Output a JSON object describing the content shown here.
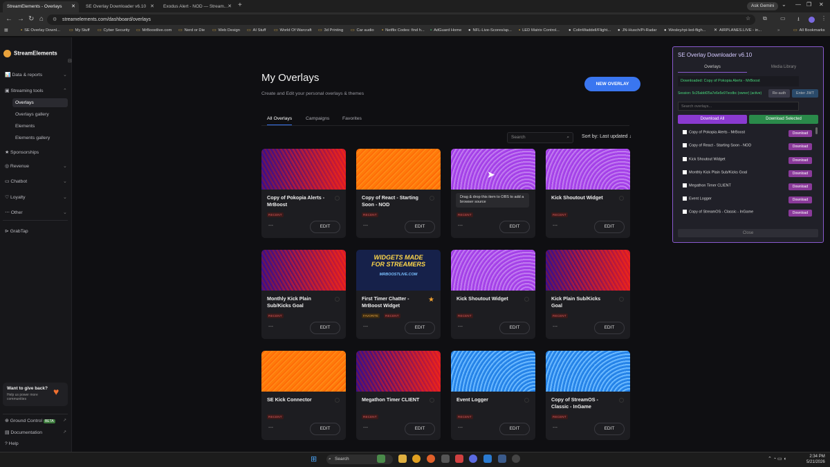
{
  "browser": {
    "tabs": [
      {
        "label": "StreamElements - Overlays"
      },
      {
        "label": "SE Overlay Downloader v6.10"
      },
      {
        "label": "Exodus Alert - NOD — Stream..."
      }
    ],
    "ask_gemini": "Ask Gemini",
    "url": "streamelements.com/dashboard/overlays",
    "bookmarks": [
      "SE Overlay Downl...",
      "My Stuff",
      "Cyber Security",
      "MrBoostlive.com",
      "Nerd or Die",
      "Web Design",
      "AI Stuff",
      "World Of Warcraft",
      "3d Printing",
      "Car audio",
      "Netflix Codes: find h...",
      "AdGuard Home",
      "NFL-Live-Scores/ap...",
      "LED Matrix Control...",
      "ColinWaddell/Flight...",
      "JN-Husch/Pi-Radar",
      "Wesley/rpi-led-fligh...",
      "AIRPLANES.LIVE - in...",
      "All Bookmarks"
    ]
  },
  "sidebar": {
    "brand": "StreamElements",
    "items": [
      {
        "label": "Data & reports"
      },
      {
        "label": "Streaming tools"
      },
      {
        "label": "Overlays"
      },
      {
        "label": "Overlays gallery"
      },
      {
        "label": "Elements"
      },
      {
        "label": "Elements gallery"
      },
      {
        "label": "Sponsorships"
      },
      {
        "label": "Revenue"
      },
      {
        "label": "Chatbot"
      },
      {
        "label": "Loyalty"
      },
      {
        "label": "Other"
      },
      {
        "label": "GrabTap"
      }
    ],
    "giveback_title": "Want to give back?",
    "giveback_text": "Help us power more communities",
    "footer": [
      {
        "label": "Ground Control",
        "badge": "BETA"
      },
      {
        "label": "Documentation"
      },
      {
        "label": "Help"
      }
    ]
  },
  "main": {
    "title": "My Overlays",
    "subtitle": "Create and Edit your personal overlays & themes",
    "new_button": "NEW OVERLAY",
    "tabs": [
      "All Overlays",
      "Campaigns",
      "Favorites"
    ],
    "search_placeholder": "Search",
    "sort": "Sort by: Last updated",
    "tooltip": "Drag & drop this item to OBS to add a browser source",
    "edit_label": "EDIT",
    "dash": "---",
    "widget_thumb_line1": "WIDGETS MADE",
    "widget_thumb_line2": "FOR STREAMERS",
    "widget_thumb_url": "MRBOOSTLIVE.COM",
    "cards": [
      {
        "name": "Copy of Pokopia Alerts - MrBoost",
        "tag": "RECENT"
      },
      {
        "name": "Copy of React - Starting Soon - NOD",
        "tag": "RECENT"
      },
      {
        "name": "",
        "tag": "RECENT"
      },
      {
        "name": "Kick Shoutout Widget",
        "tag": "RECENT"
      },
      {
        "name": "Monthly Kick Plain Sub/Kicks Goal",
        "tag": "RECENT"
      },
      {
        "name": "First Timer Chatter - MrBoost Widget",
        "tag": "RECENT",
        "tag2": "FAVORITE"
      },
      {
        "name": "Kick Shoutout Widget",
        "tag": "RECENT"
      },
      {
        "name": "Kick Plain Sub/Kicks Goal",
        "tag": "RECENT"
      },
      {
        "name": "SE Kick Connector",
        "tag": "RECENT"
      },
      {
        "name": "Megathon Timer CLIENT",
        "tag": "RECENT"
      },
      {
        "name": "Event Logger",
        "tag": "RECENT"
      },
      {
        "name": "Copy of StreamOS - Classic - InGame",
        "tag": "RECENT"
      }
    ]
  },
  "extension": {
    "title": "SE Overlay Downloader v6.10",
    "tabs": [
      "Overlays",
      "Media Library"
    ],
    "status": "Downloaded: Copy of Pokopia Alerts - MrBoost",
    "session": "Session: 5c25abbf25a7e6e5e97ecdbc (owner) (active)",
    "reauth": "Re-auth",
    "enter_jwt": "Enter JWT",
    "search_placeholder": "Search overlays...",
    "download_all": "Download All",
    "download_selected": "Download Selected",
    "download_label": "Download",
    "rows": [
      "Copy of Pokopia Alerts - MrBoost",
      "Copy of React - Starting Soon - NOD",
      "Kick Shoutout Widget",
      "Monthly Kick Plain Sub/Kicks Goal",
      "Megathon Timer CLIENT",
      "Event Logger",
      "Copy of StreamOS - Classic - InGame"
    ],
    "close": "Close"
  },
  "taskbar": {
    "search": "Search",
    "time": "2:34 PM",
    "date": "5/21/2026"
  },
  "colors": {
    "accent": "#3a76f0",
    "purple": "#8a3ad0",
    "green": "#2a8a4a",
    "tag_red": "#e05a5a"
  }
}
